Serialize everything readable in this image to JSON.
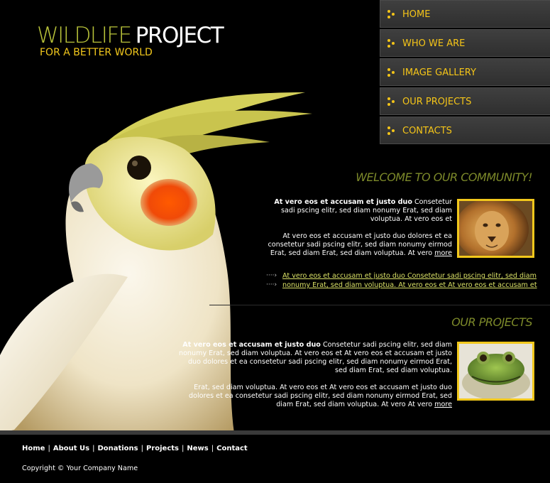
{
  "logo": {
    "title_part1": "WILDLIFE",
    "title_part2": "PROJECT",
    "subtitle": "FOR A BETTER WORLD"
  },
  "nav": {
    "items": [
      {
        "label": "HOME"
      },
      {
        "label": "WHO WE ARE"
      },
      {
        "label": "IMAGE GALLERY"
      },
      {
        "label": "OUR PROJECTS"
      },
      {
        "label": "CONTACTS"
      }
    ]
  },
  "welcome": {
    "heading": "WELCOME TO OUR COMMUNITY!",
    "p1_bold": "At vero eos et accusam et justo duo",
    "p1_text": " Consetetur sadi pscing elitr, sed diam nonumy Erat, sed diam voluptua. At vero eos et",
    "p2_text": "At vero eos et accusam et justo duo dolores et ea consetetur sadi pscing elitr, sed diam nonumy eirmod Erat, sed diam Erat, sed diam voluptua. At vero ",
    "p2_more": "more",
    "links": [
      {
        "text": "At vero eos et accusam et justo duo Consetetur sadi pscing elitr, sed diam"
      },
      {
        "text": "nonumy Erat, sed diam voluptua. At vero eos et At vero eos et accusam et"
      }
    ],
    "arrow": "····›"
  },
  "projects": {
    "heading": "OUR PROJECTS",
    "p1_bold": "At vero eos et accusam et justo duo",
    "p1_text": " Consetetur sadi pscing elitr, sed diam nonumy Erat, sed diam voluptua. At vero eos et At vero eos et accusam et justo duo dolores et ea consetetur sadi pscing elitr, sed diam nonumy eirmod Erat, sed diam Erat, sed diam voluptua.",
    "p2_text": "Erat, sed diam voluptua. At vero eos et At vero eos et accusam et justo duo dolores et ea consetetur sadi pscing elitr, sed diam nonumy eirmod Erat, sed diam Erat, sed diam voluptua. At vero At vero ",
    "p2_more": "more"
  },
  "footer": {
    "links": [
      {
        "label": "Home"
      },
      {
        "label": "About Us"
      },
      {
        "label": "Donations"
      },
      {
        "label": "Projects"
      },
      {
        "label": "News"
      },
      {
        "label": "Contact"
      }
    ],
    "separator": "|",
    "copyright": "Copyright © Your Company Name"
  },
  "colors": {
    "accent_yellow": "#f2c81c",
    "heading_olive": "#7d8a2a",
    "link_green": "#d9e066",
    "nav_bg": "#353535"
  }
}
